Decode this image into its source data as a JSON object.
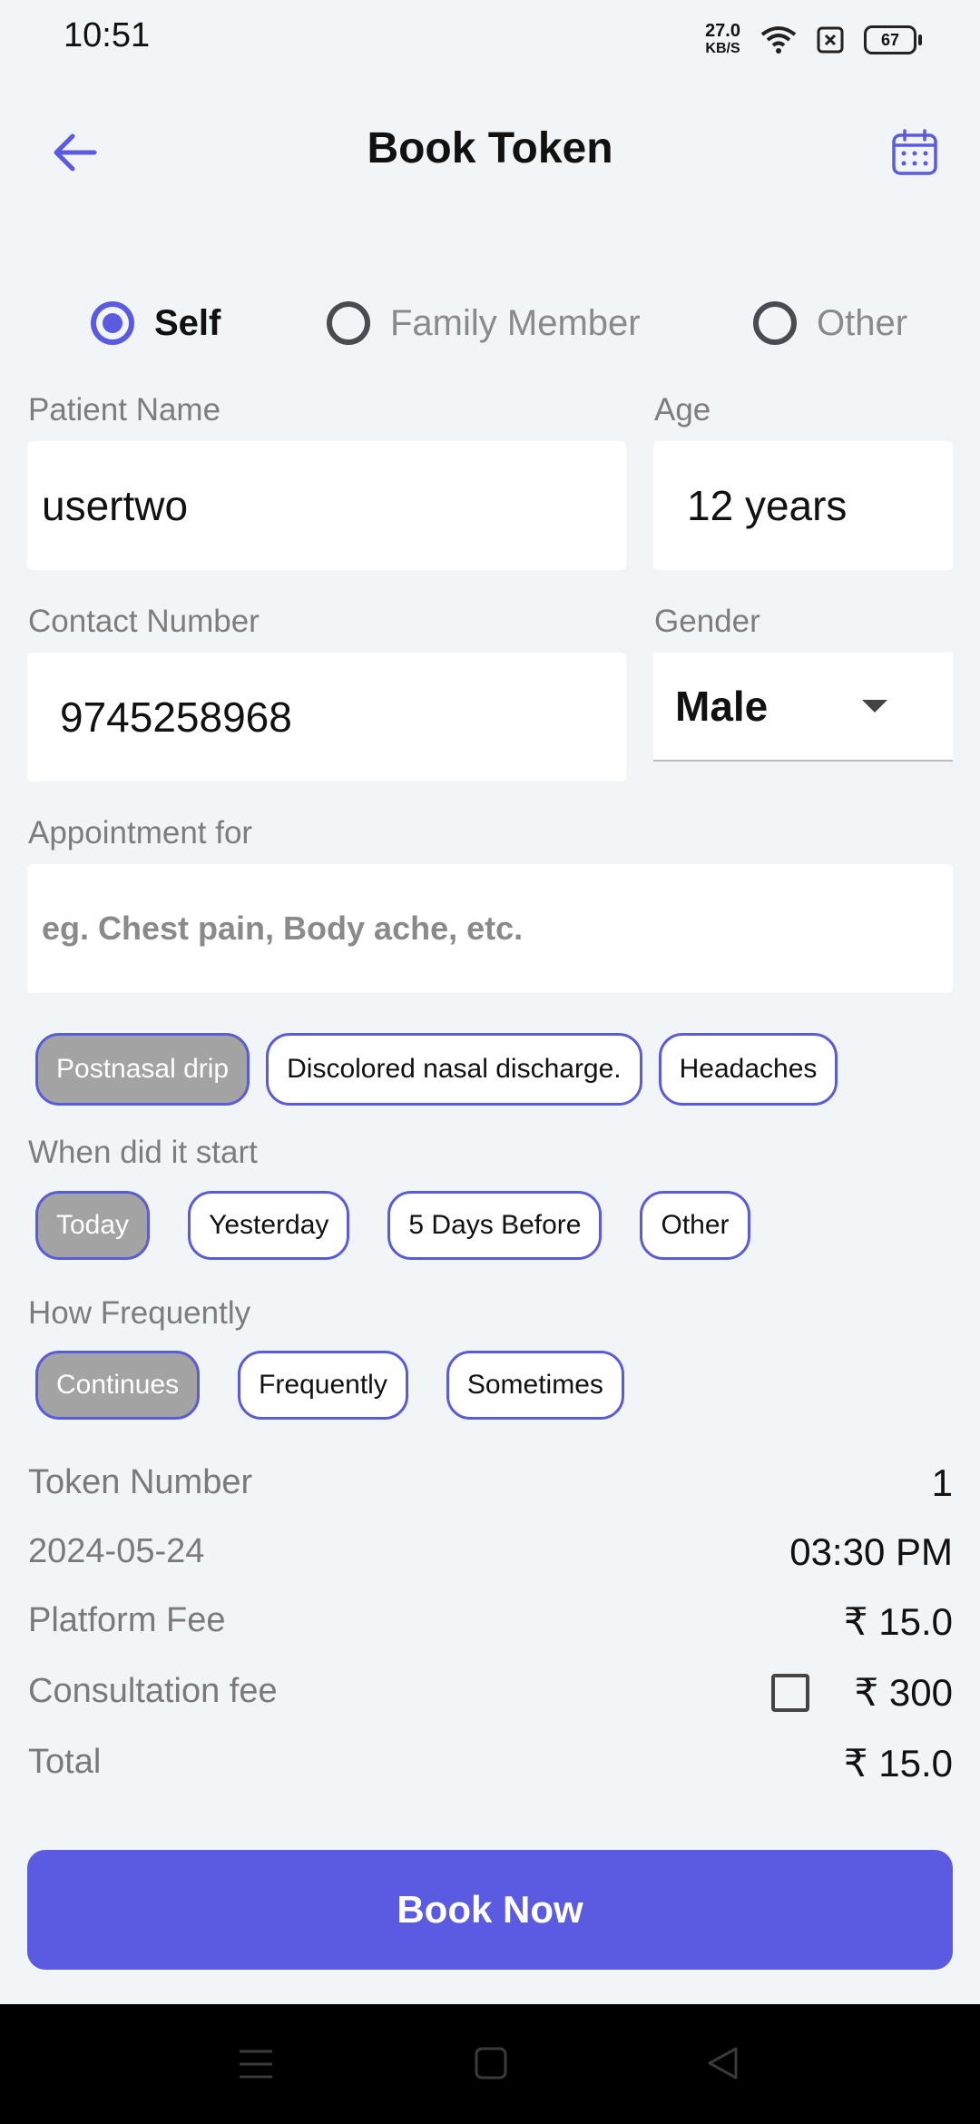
{
  "status_bar": {
    "time": "10:51",
    "net_speed_value": "27.0",
    "net_speed_unit": "KB/S",
    "battery": "67"
  },
  "header": {
    "title": "Book Token",
    "back_icon": "arrow-left-icon",
    "calendar_icon": "calendar-icon"
  },
  "patient_type": {
    "options": [
      "Self",
      "Family Member",
      "Other"
    ],
    "selected": "Self"
  },
  "form": {
    "patient_name_label": "Patient Name",
    "patient_name_value": "usertwo",
    "age_label": "Age",
    "age_value": "12 years",
    "contact_label": "Contact Number",
    "contact_value": "9745258968",
    "gender_label": "Gender",
    "gender_value": "Male",
    "appointment_label": "Appointment for",
    "appointment_placeholder": "eg. Chest pain, Body ache, etc."
  },
  "symptoms": {
    "chips": [
      "Postnasal drip",
      "Discolored nasal discharge.",
      "Headaches"
    ],
    "selected": "Postnasal drip"
  },
  "start": {
    "label": "When did it start",
    "chips": [
      "Today",
      "Yesterday",
      "5 Days Before",
      "Other"
    ],
    "selected": "Today"
  },
  "frequency": {
    "label": "How Frequently",
    "chips": [
      "Continues",
      "Frequently",
      "Sometimes"
    ],
    "selected": "Continues"
  },
  "summary": {
    "token_label": "Token Number",
    "token_value": "1",
    "date": "2024-05-24",
    "time": "03:30 PM",
    "platform_fee_label": "Platform Fee",
    "platform_fee_value": "₹ 15.0",
    "consultation_fee_label": "Consultation fee",
    "consultation_fee_value": "₹ 300",
    "consultation_checked": false,
    "total_label": "Total",
    "total_value": "₹ 15.0"
  },
  "book_button": "Book Now",
  "colors": {
    "accent": "#5a5be0",
    "background": "#f2f5f7",
    "chip_selected": "#a3a3a3"
  }
}
